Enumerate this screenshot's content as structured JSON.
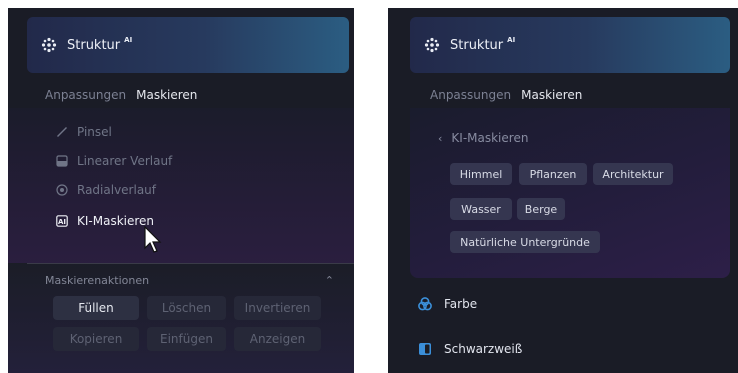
{
  "left": {
    "header_title": "Struktur",
    "ai_badge": "AI",
    "tabs": [
      "Anpassungen",
      "Maskieren"
    ],
    "tools": [
      {
        "label": "Pinsel",
        "icon": "brush-icon"
      },
      {
        "label": "Linearer Verlauf",
        "icon": "linear-gradient-icon"
      },
      {
        "label": "Radialverlauf",
        "icon": "radial-gradient-icon"
      },
      {
        "label": "KI-Maskieren",
        "icon": "ai-mask-icon"
      }
    ],
    "actions_title": "Maskierenaktionen",
    "actions": [
      [
        "Füllen",
        "Löschen",
        "Invertieren"
      ],
      [
        "Kopieren",
        "Einfügen",
        "Anzeigen"
      ]
    ]
  },
  "right": {
    "header_title": "Struktur",
    "ai_badge": "AI",
    "tabs": [
      "Anpassungen",
      "Maskieren"
    ],
    "back_label": "KI-Maskieren",
    "chips": [
      [
        "Himmel",
        "Pflanzen",
        "Architektur"
      ],
      [
        "Wasser",
        "Berge"
      ],
      [
        "Natürliche Untergründe"
      ]
    ],
    "categories": [
      {
        "label": "Farbe",
        "icon": "color-circles-icon"
      },
      {
        "label": "Schwarzweiß",
        "icon": "black-white-icon"
      }
    ]
  },
  "colors": {
    "panel_bg": "#1a1c26",
    "header_gradient_start": "#22294a",
    "header_gradient_end": "#2b5d82",
    "chip_bg": "#353650",
    "color_icon_blue": "#3b8fd9"
  }
}
